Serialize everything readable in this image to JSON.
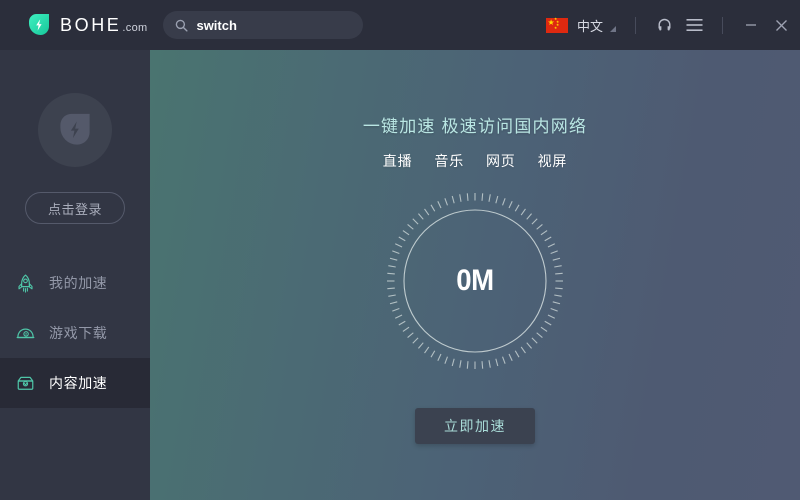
{
  "titlebar": {
    "brand_name": "BOHE",
    "brand_tld": ".com",
    "logo_icon": "bohe-droplet-logo-icon",
    "search": {
      "icon": "search-icon",
      "value": "switch",
      "placeholder": "Search"
    },
    "language": {
      "flag_icon": "china-flag-icon",
      "label": "中文",
      "caret_icon": "caret-down-icon"
    },
    "support_icon": "headset-icon",
    "menu_icon": "hamburger-menu-icon",
    "minimize_icon": "minimize-icon",
    "close_icon": "close-icon"
  },
  "sidebar": {
    "avatar_icon": "avatar-droplet-icon",
    "login_label": "点击登录",
    "items": [
      {
        "label": "我的加速",
        "icon": "rocket-icon",
        "active": false
      },
      {
        "label": "游戏下载",
        "icon": "gamepad-icon",
        "active": false
      },
      {
        "label": "内容加速",
        "icon": "archive-box-icon",
        "active": true
      }
    ]
  },
  "main": {
    "hero_title": "一键加速 极速访问国内网络",
    "tags": [
      "直播",
      "音乐",
      "网页",
      "视屏"
    ],
    "gauge": {
      "value": "0M",
      "ticks": 72
    },
    "cta_label": "立即加速"
  },
  "colors": {
    "accent_teal": "#2fe0b0",
    "titlebar_bg": "#2b2e3b",
    "sidebar_bg": "#323644",
    "sidebar_active_bg": "#282a36",
    "main_gradient_start": "#4a7470",
    "main_gradient_end": "#505a73",
    "hero_title_color": "#b9e6e3",
    "cta_bg": "#3b4250",
    "cta_text": "#a9dcd8",
    "flag_red": "#de2910",
    "flag_yellow": "#ffde00"
  }
}
